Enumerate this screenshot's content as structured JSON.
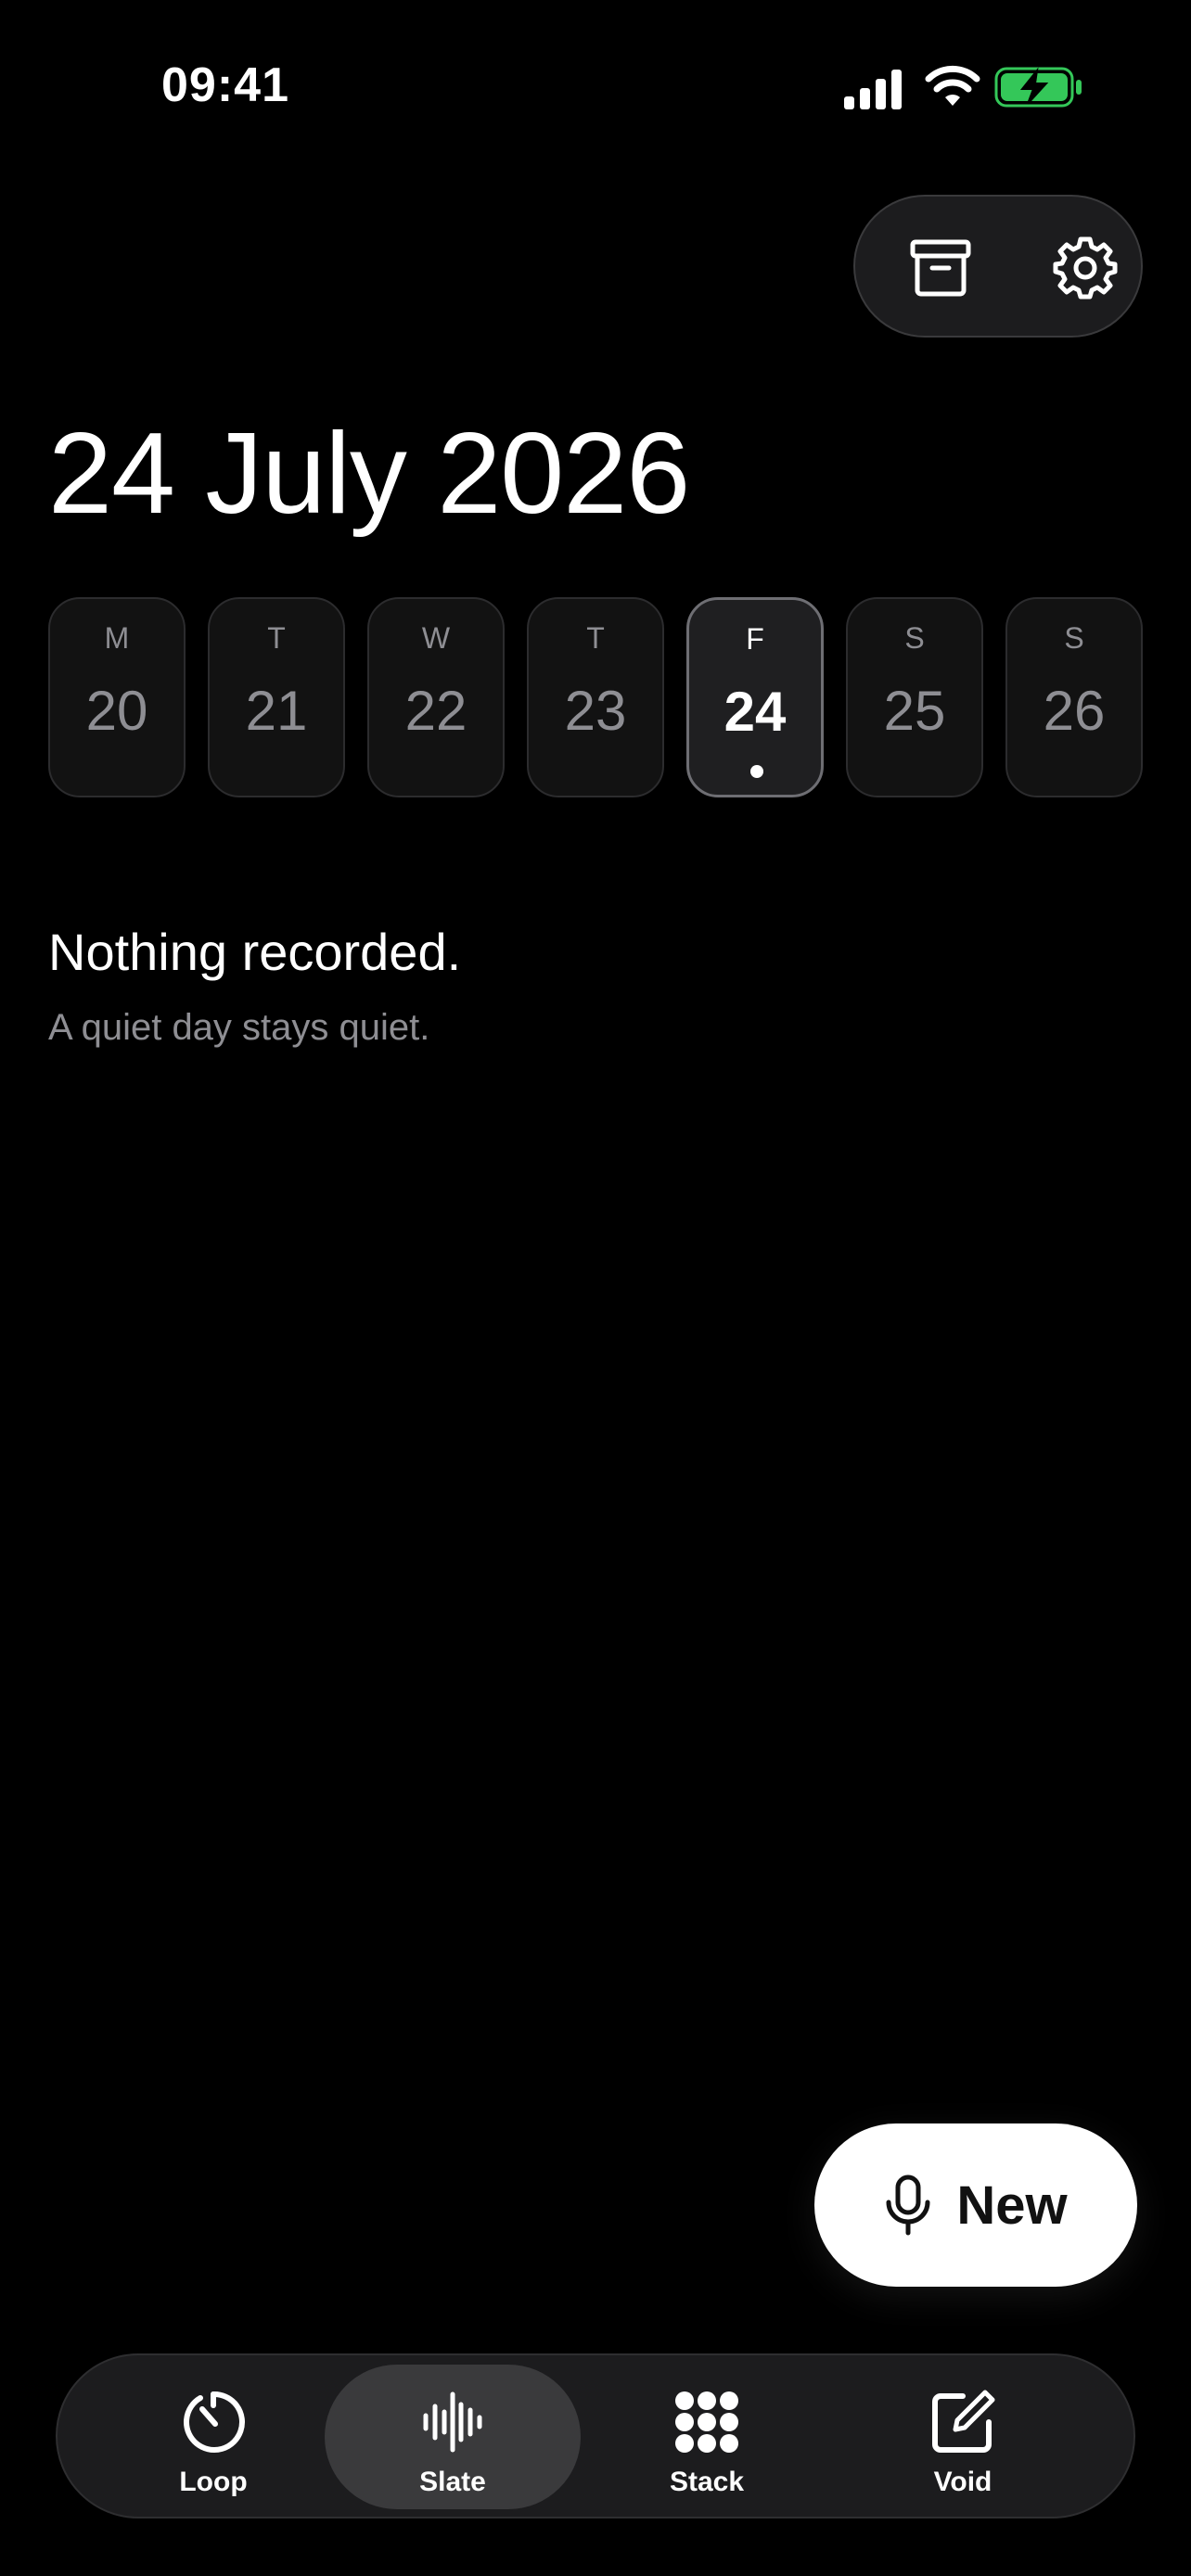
{
  "status_bar": {
    "time": "09:41"
  },
  "header": {
    "date_title": "24 July 2026"
  },
  "week": [
    {
      "weekday": "M",
      "day": "20",
      "selected": false
    },
    {
      "weekday": "T",
      "day": "21",
      "selected": false
    },
    {
      "weekday": "W",
      "day": "22",
      "selected": false
    },
    {
      "weekday": "T",
      "day": "23",
      "selected": false
    },
    {
      "weekday": "F",
      "day": "24",
      "selected": true
    },
    {
      "weekday": "S",
      "day": "25",
      "selected": false
    },
    {
      "weekday": "S",
      "day": "26",
      "selected": false
    }
  ],
  "empty_state": {
    "title": "Nothing recorded.",
    "subtitle": "A quiet day stays quiet."
  },
  "new_button": {
    "label": "New",
    "icon": "microphone-icon"
  },
  "tabs": [
    {
      "label": "Loop",
      "icon": "timer-icon",
      "active": false
    },
    {
      "label": "Slate",
      "icon": "waveform-icon",
      "active": true
    },
    {
      "label": "Stack",
      "icon": "grid-icon",
      "active": false
    },
    {
      "label": "Void",
      "icon": "compose-icon",
      "active": false
    }
  ],
  "colors": {
    "background": "#000000",
    "battery_fill": "#34c759",
    "muted_text": "#8e8e93"
  }
}
